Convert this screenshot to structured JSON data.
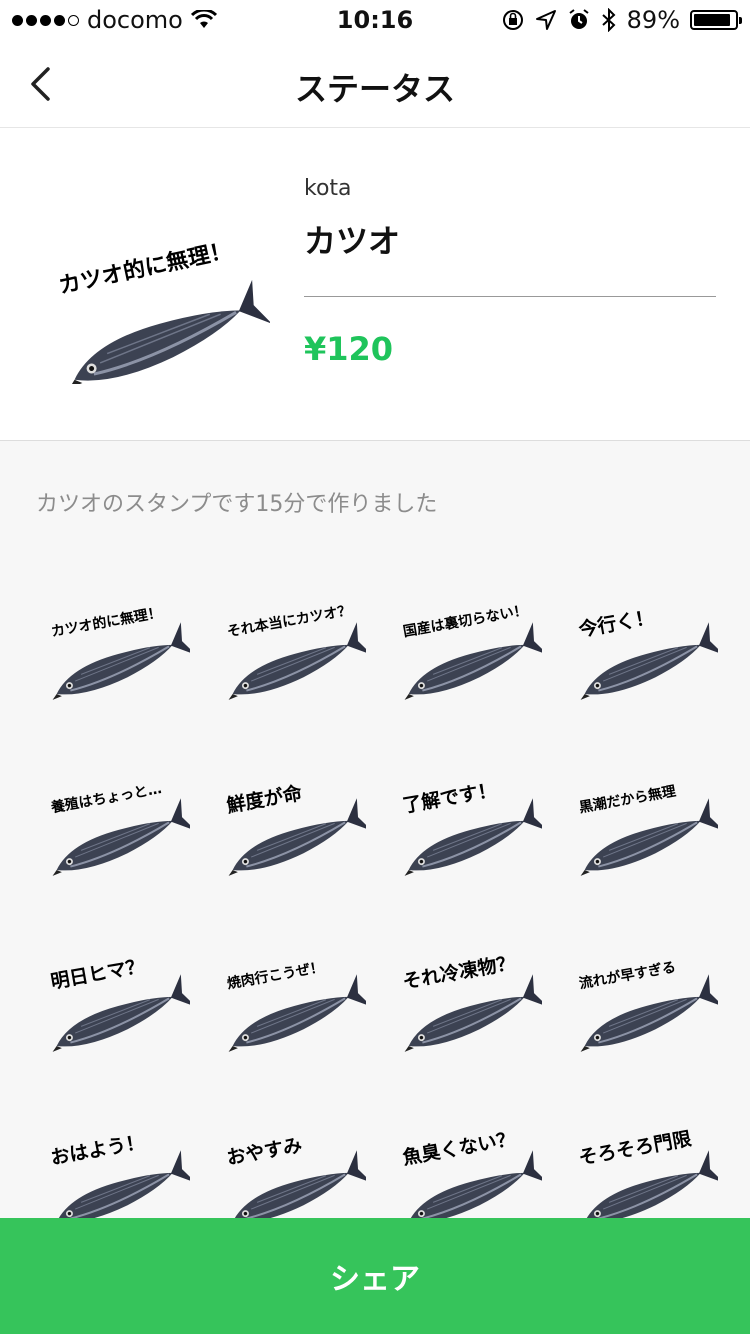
{
  "status_bar": {
    "carrier": "docomo",
    "time": "10:16",
    "battery": "89%",
    "battery_level": 0.89,
    "icons": [
      "signal-dots-icon",
      "wifi-icon",
      "orientation-lock-icon",
      "location-icon",
      "alarm-icon",
      "bluetooth-icon",
      "battery-icon"
    ]
  },
  "nav": {
    "title": "ステータス",
    "back_icon": "chevron-left-icon"
  },
  "sticker_set": {
    "author": "kota",
    "name": "カツオ",
    "price": "¥120",
    "main_caption": "カツオ的に無理！",
    "description": "カツオのスタンプです15分で作りました"
  },
  "stickers": [
    "カツオ的に無理！",
    "それ本当にカツオ？",
    "国産は裏切らない！",
    "今行く！",
    "養殖はちょっと…",
    "鮮度が命",
    "了解です！",
    "黒潮だから無理",
    "明日ヒマ？",
    "焼肉行こうぜ！",
    "それ冷凍物？",
    "流れが早すぎる",
    "おはよう！",
    "おやすみ",
    "魚臭くない？",
    "そろそろ門限"
  ],
  "share_label": "シェア",
  "colors": {
    "price": "#1fc45b",
    "share_button": "#36c45b",
    "fish_body": "#3c4252"
  }
}
